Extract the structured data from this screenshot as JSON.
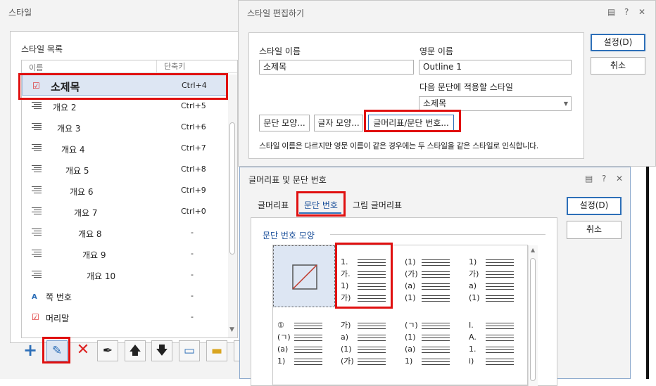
{
  "style_window": {
    "title": "스타일",
    "list_title": "스타일 목록",
    "col_name": "이름",
    "col_shortcut": "단축키",
    "rows": [
      {
        "name": "소제목",
        "shortcut": "Ctrl+4",
        "icon": "check-style-icon"
      },
      {
        "name": "개요 2",
        "shortcut": "Ctrl+5",
        "icon": "paragraph-style-icon"
      },
      {
        "name": "개요 3",
        "shortcut": "Ctrl+6",
        "icon": "paragraph-style-icon"
      },
      {
        "name": "개요 4",
        "shortcut": "Ctrl+7",
        "icon": "paragraph-style-icon"
      },
      {
        "name": "개요 5",
        "shortcut": "Ctrl+8",
        "icon": "paragraph-style-icon"
      },
      {
        "name": "개요 6",
        "shortcut": "Ctrl+9",
        "icon": "paragraph-style-icon"
      },
      {
        "name": "개요 7",
        "shortcut": "Ctrl+0",
        "icon": "paragraph-style-icon"
      },
      {
        "name": "개요 8",
        "shortcut": "-",
        "icon": "paragraph-style-icon"
      },
      {
        "name": "개요 9",
        "shortcut": "-",
        "icon": "paragraph-style-icon"
      },
      {
        "name": "개요 10",
        "shortcut": "-",
        "icon": "paragraph-style-icon"
      },
      {
        "name": "쪽 번호",
        "shortcut": "-",
        "icon": "character-style-icon"
      },
      {
        "name": "머리말",
        "shortcut": "-",
        "icon": "check-style-icon"
      }
    ]
  },
  "edit_dialog": {
    "title": "스타일 편집하기",
    "style_name_label": "스타일 이름",
    "style_name_value": "소제목",
    "english_name_label": "영문 이름",
    "english_name_value": "Outline 1",
    "next_style_label": "다음 문단에 적용할 스타일",
    "next_style_value": "소제목",
    "para_shape_button": "문단 모양...",
    "char_shape_button": "글자 모양...",
    "bullet_button": "글머리표/문단 번호...",
    "note": "스타일 이름은 다르지만 영문 이름이 같은 경우에는 두 스타일을 같은 스타일로 인식합니다.",
    "ok_button": "설정(D)",
    "cancel_button": "취소"
  },
  "bullet_dialog": {
    "title": "글머리표 및 문단 번호",
    "tabs": [
      "글머리표",
      "문단 번호",
      "그림 글머리표"
    ],
    "section_label": "문단 번호 모양",
    "ok_button": "설정(D)",
    "cancel_button": "취소",
    "presets": [
      {
        "lines": []
      },
      {
        "lines": [
          "1.",
          "가.",
          "1)",
          "가)"
        ]
      },
      {
        "lines": [
          "(1)",
          "(가)",
          "(a)",
          "(1)"
        ]
      },
      {
        "lines": [
          "1)",
          "가)",
          "a)",
          "(1)"
        ]
      },
      {
        "lines": [
          "①",
          "(ㄱ)",
          "(a)",
          "1)"
        ]
      },
      {
        "lines": [
          "가)",
          "a)",
          "(1)",
          "(가)"
        ]
      },
      {
        "lines": [
          "(ㄱ)",
          "(1)",
          "(a)",
          "1)"
        ]
      },
      {
        "lines": [
          "I.",
          "A.",
          "1.",
          "i)"
        ]
      }
    ]
  }
}
